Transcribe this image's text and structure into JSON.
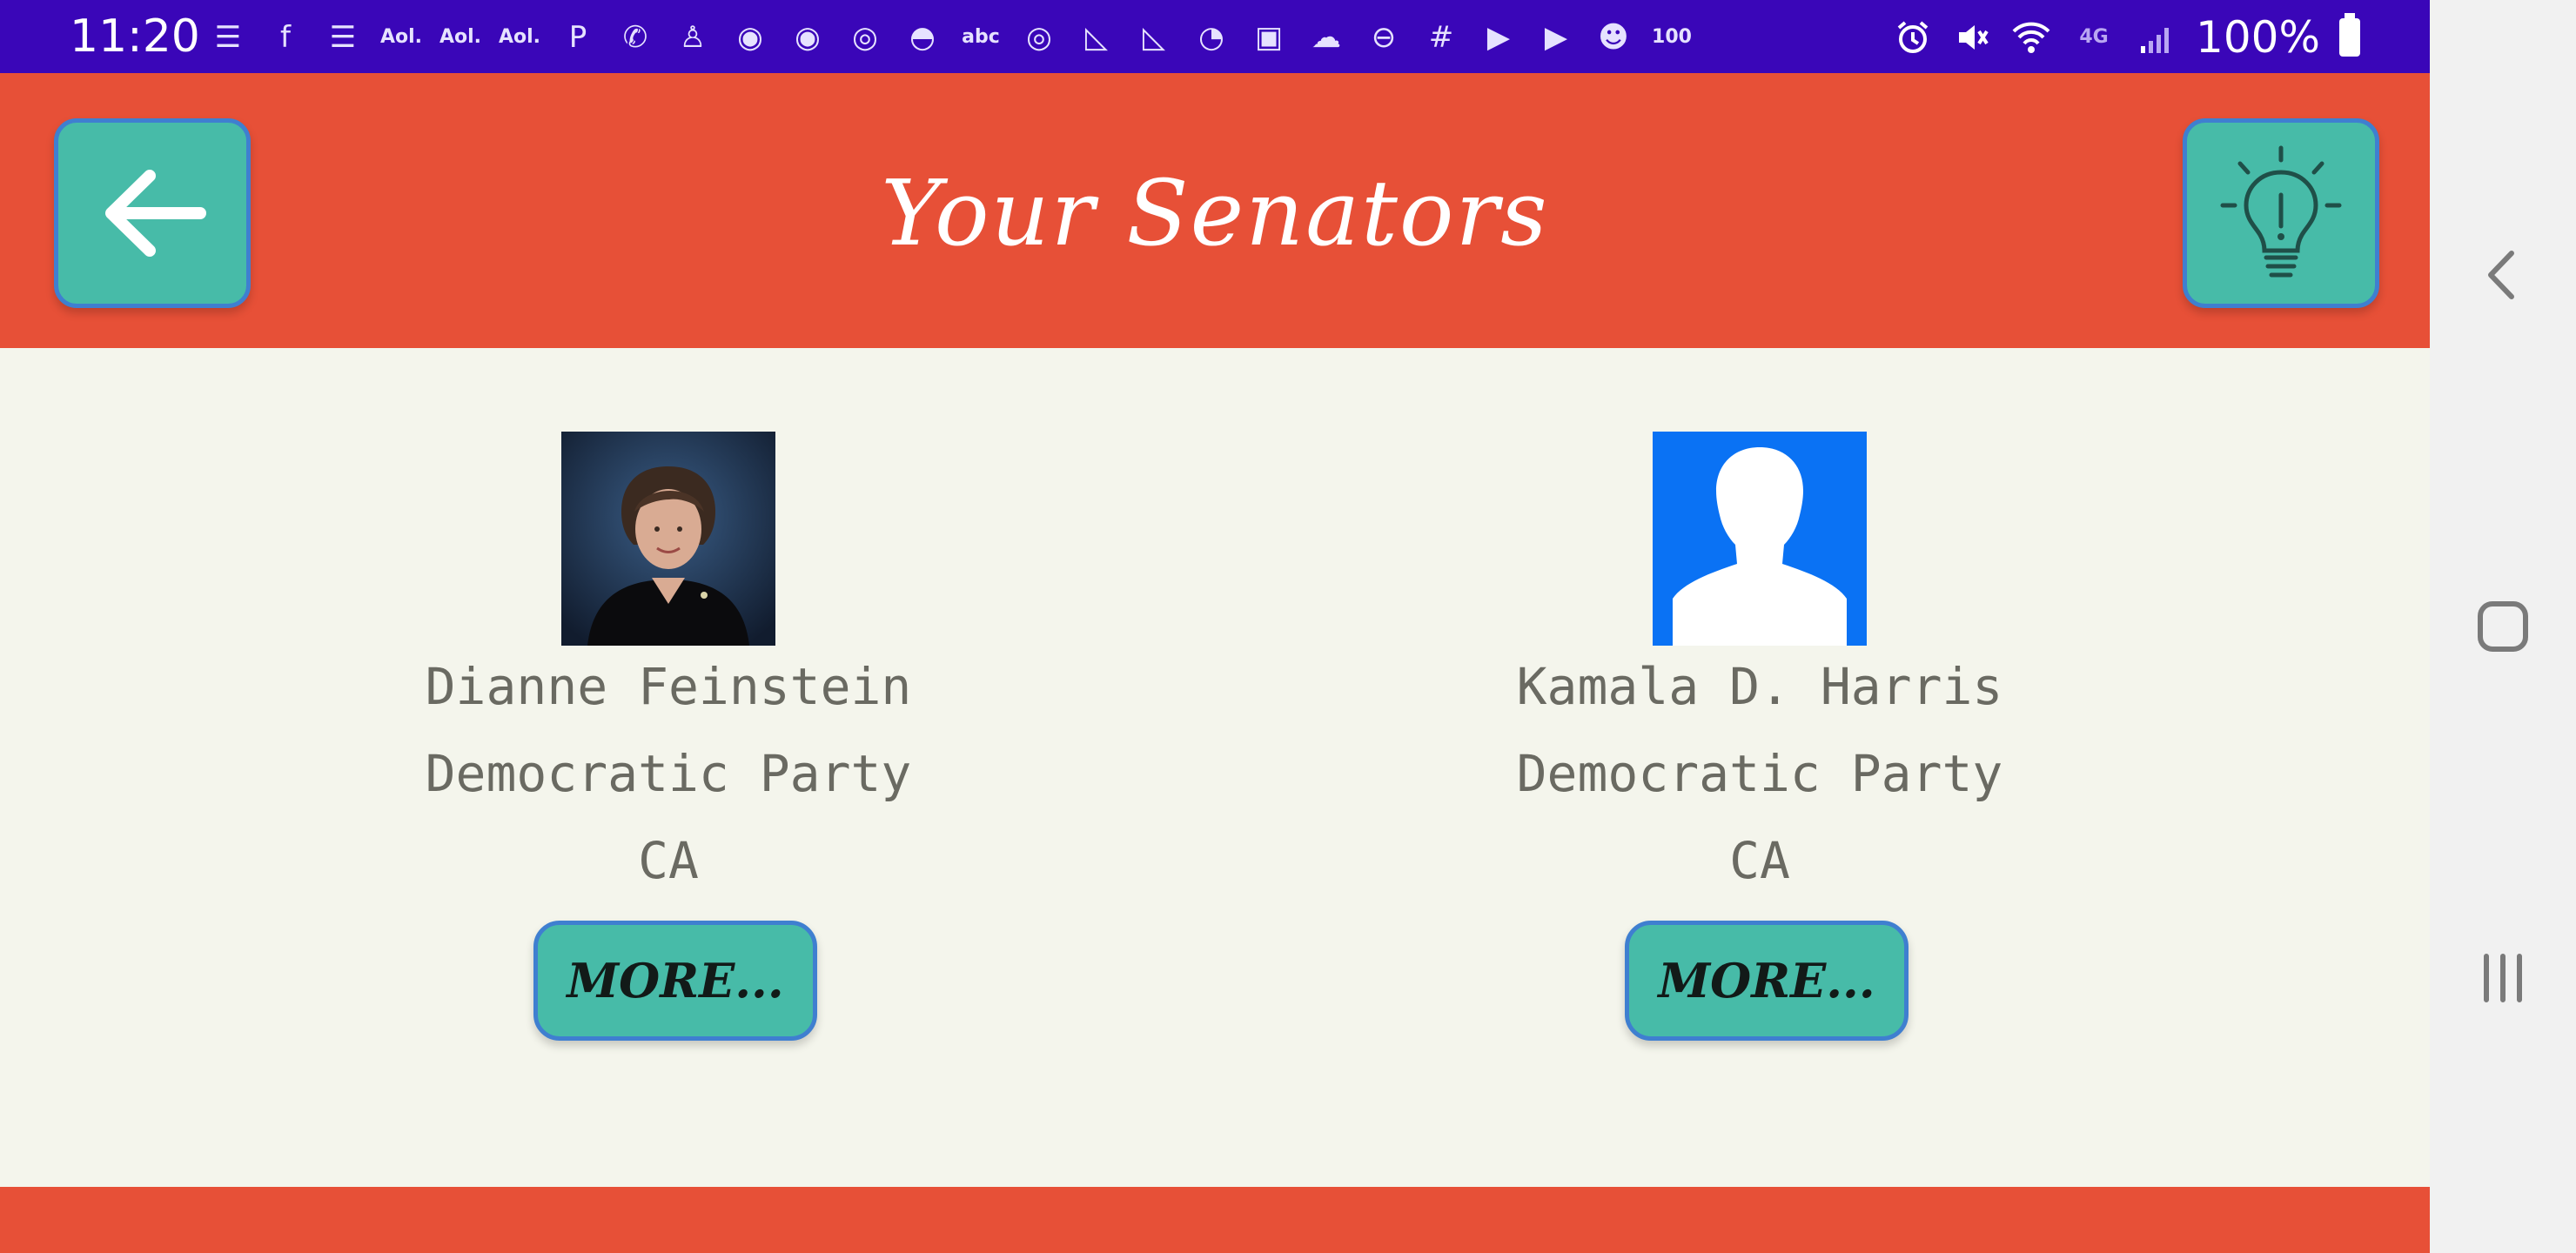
{
  "status_bar": {
    "time": "11:20",
    "notification_icons": [
      {
        "name": "news-app-icon",
        "glyph": "☰",
        "text": false
      },
      {
        "name": "facebook-icon",
        "glyph": "f",
        "text": false
      },
      {
        "name": "news-app-icon",
        "glyph": "☰",
        "text": false
      },
      {
        "name": "aol-icon",
        "glyph": "Aol.",
        "text": true
      },
      {
        "name": "aol-icon",
        "glyph": "Aol.",
        "text": true
      },
      {
        "name": "aol-icon",
        "glyph": "Aol.",
        "text": true
      },
      {
        "name": "pinterest-icon",
        "glyph": "P",
        "text": false
      },
      {
        "name": "wifi-call-icon",
        "glyph": "✆",
        "text": false
      },
      {
        "name": "person-icon",
        "glyph": "♙",
        "text": false
      },
      {
        "name": "reddit-icon",
        "glyph": "◉",
        "text": false
      },
      {
        "name": "reddit-icon",
        "glyph": "◉",
        "text": false
      },
      {
        "name": "instagram-icon",
        "glyph": "◎",
        "text": false
      },
      {
        "name": "cloud-half-icon",
        "glyph": "◓",
        "text": false
      },
      {
        "name": "abc-icon",
        "glyph": "abc",
        "text": true
      },
      {
        "name": "instagram-icon",
        "glyph": "◎",
        "text": false
      },
      {
        "name": "pizza-icon",
        "glyph": "◺",
        "text": false
      },
      {
        "name": "pizza-icon",
        "glyph": "◺",
        "text": false
      },
      {
        "name": "speed-icon",
        "glyph": "◔",
        "text": false
      },
      {
        "name": "image-icon",
        "glyph": "▣",
        "text": false
      },
      {
        "name": "cloud-icon",
        "glyph": "☁",
        "text": false
      },
      {
        "name": "do-not-disturb-icon",
        "glyph": "⊖",
        "text": false
      },
      {
        "name": "chat-icon",
        "glyph": "#",
        "text": false
      },
      {
        "name": "youtube-icon",
        "glyph": "▶",
        "text": false
      },
      {
        "name": "youtube-icon",
        "glyph": "▶",
        "text": false
      },
      {
        "name": "ghost-icon",
        "glyph": "☻",
        "text": false
      },
      {
        "name": "battery-100-icon",
        "glyph": "100",
        "text": true
      }
    ],
    "system_icons": [
      {
        "name": "alarm-icon",
        "glyph": "⏰"
      },
      {
        "name": "mute-icon",
        "glyph": "🔇"
      },
      {
        "name": "wifi-icon",
        "glyph": "⌔"
      },
      {
        "name": "lte-icon",
        "glyph": "4G"
      },
      {
        "name": "signal-icon",
        "glyph": "▂"
      }
    ],
    "battery_percent": "100%"
  },
  "header": {
    "title": "Your Senators",
    "back_icon": "arrow-left-icon",
    "idea_icon": "lightbulb-icon"
  },
  "senators": [
    {
      "name": "Dianne Feinstein",
      "party": "Democratic Party",
      "state": "CA",
      "more_label": "MORE...",
      "photo": "portrait-photo"
    },
    {
      "name": "Kamala D. Harris",
      "party": "Democratic Party",
      "state": "CA",
      "more_label": "MORE...",
      "photo": "default-avatar"
    }
  ],
  "colors": {
    "status_bar": "#3a06b8",
    "header": "#e75037",
    "accent_button": "#47bba8",
    "button_border": "#3f7fd0",
    "background": "#f4f5ec",
    "text_gray": "#6a6a62",
    "avatar_blue": "#0a72f4"
  },
  "nav_rail": {
    "back_icon": "chevron-left-icon",
    "home_icon": "home-square-icon",
    "recents_icon": "recents-icon"
  }
}
